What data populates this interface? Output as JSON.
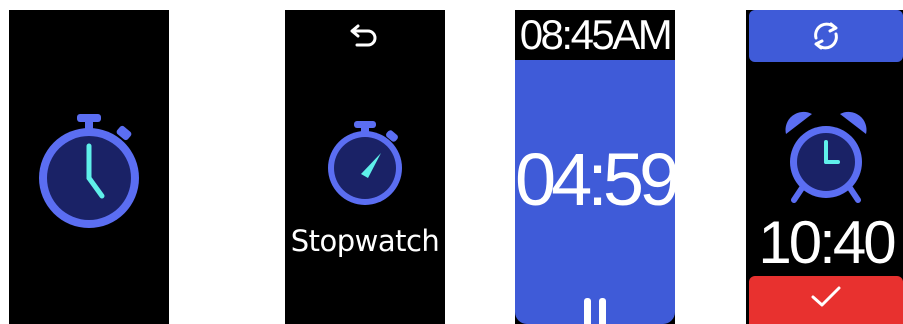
{
  "screens": {
    "stopwatch_icon": {
      "icon": "stopwatch-icon"
    },
    "stopwatch_menu": {
      "back_icon": "back-arrow-icon",
      "icon": "stopwatch-icon",
      "label": "Stopwatch"
    },
    "timer": {
      "clock": "08:45AM",
      "countdown": "04:59",
      "pause_icon": "pause-icon"
    },
    "alarm": {
      "repeat_icon": "repeat-icon",
      "alarm_icon": "alarm-clock-icon",
      "time": "10:40",
      "confirm_icon": "check-icon"
    }
  },
  "colors": {
    "screen_bg": "#000000",
    "accent_blue": "#3f5bd8",
    "icon_blue": "#5b6ef2",
    "icon_dark": "#1a2266",
    "hand_cyan": "#5ff0ea",
    "confirm_red": "#e8312f",
    "text_white": "#ffffff"
  }
}
